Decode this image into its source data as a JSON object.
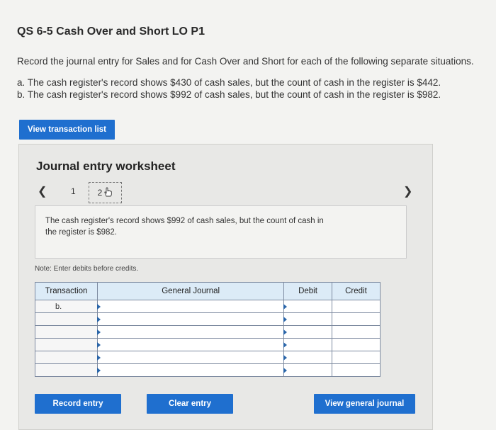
{
  "title": "QS 6-5 Cash Over and Short LO P1",
  "instructions": "Record the journal entry for Sales and for Cash Over and Short for each of the following separate situations.",
  "situations": [
    "a. The cash register's record shows $430 of cash sales, but the count of cash in the register is $442.",
    "b. The cash register's record shows $992 of cash sales, but the count of cash in the register is $982."
  ],
  "buttons": {
    "view_transaction_list": "View transaction list",
    "record_entry": "Record entry",
    "clear_entry": "Clear entry",
    "view_general_journal": "View general journal"
  },
  "worksheet": {
    "title": "Journal entry worksheet",
    "pages": [
      "1",
      "2"
    ],
    "current_page": "2",
    "description_line1": "The cash register's record shows $992 of cash sales, but the count of cash in",
    "description_line2": "the register is $982.",
    "note": "Note: Enter debits before credits."
  },
  "table": {
    "headers": [
      "Transaction",
      "General Journal",
      "Debit",
      "Credit"
    ],
    "first_transaction": "b."
  },
  "icons": [
    "chevron-left-icon",
    "chevron-right-icon",
    "hand-pointer-icon"
  ]
}
